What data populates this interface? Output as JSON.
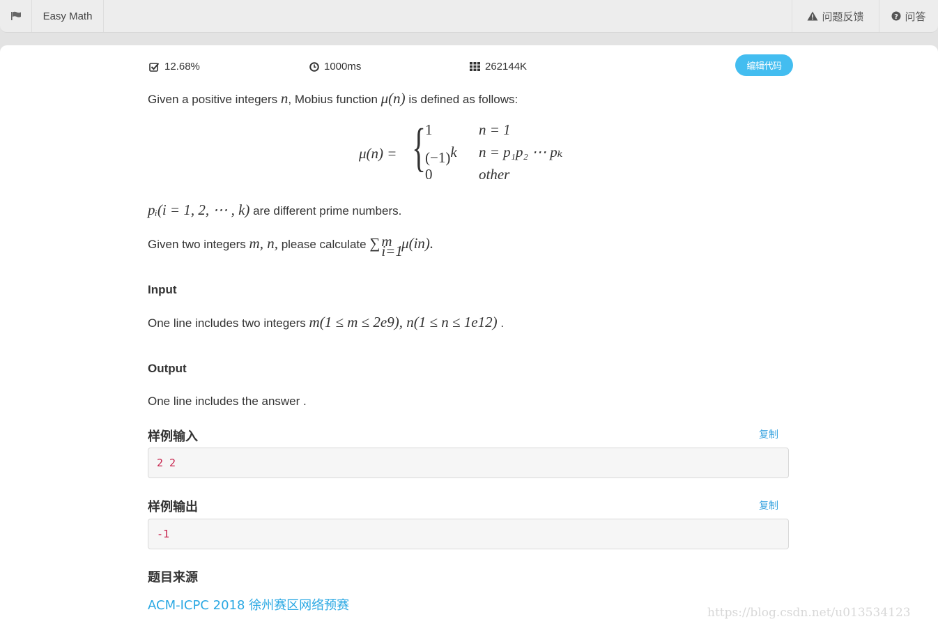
{
  "topbar": {
    "flag_icon": "flag-icon",
    "title": "Easy Math",
    "feedback_label": "问题反馈",
    "feedback_icon": "warning-icon",
    "qa_label": "问答",
    "qa_icon": "question-circle-icon"
  },
  "stats": {
    "pass_rate": "12.68%",
    "pass_rate_icon": "check-square-icon",
    "time_limit": "1000ms",
    "time_icon": "clock-icon",
    "memory_limit": "262144K",
    "memory_icon": "grid-icon"
  },
  "edit_button_label": "编辑代码",
  "description": {
    "line1_prefix": "Given a positive integers",
    "line1_n": "n",
    "line1_mid": ", Mobius function",
    "line1_mu": "μ(n)",
    "line1_suffix": "is defined as follows:",
    "formula": {
      "lhs": "μ(n) =",
      "cases": [
        {
          "value": "1",
          "condition": "n = 1"
        },
        {
          "value": "(−1)",
          "value_sup": "k",
          "condition": "n = p₁p₂ ⋯ pₖ"
        },
        {
          "value": "0",
          "condition": "other"
        }
      ]
    },
    "line2_math": "pᵢ(i = 1, 2, ⋯ , k)",
    "line2_suffix": "are different prime numbers.",
    "line3_prefix": "Given two integers",
    "line3_vars": "m, n,",
    "line3_mid": "please calculate",
    "line3_sum": "∑",
    "line3_sum_sup": "m",
    "line3_sum_sub": "i=1",
    "line3_expr": "μ(in)."
  },
  "input_section": {
    "heading": "Input",
    "text_prefix": "One line includes two integers",
    "math": "m(1 ≤ m ≤ 2e9), n(1 ≤ n ≤ 1e12)",
    "text_suffix": "."
  },
  "output_section": {
    "heading": "Output",
    "text": "One line includes the answer ."
  },
  "sample_input": {
    "heading": "样例输入",
    "copy_label": "复制",
    "value": "2 2"
  },
  "sample_output": {
    "heading": "样例输出",
    "copy_label": "复制",
    "value": "-1"
  },
  "source": {
    "heading": "题目来源",
    "link_text": "ACM-ICPC 2018 徐州赛区网络预赛"
  },
  "watermark": "https://blog.csdn.net/u013534123"
}
